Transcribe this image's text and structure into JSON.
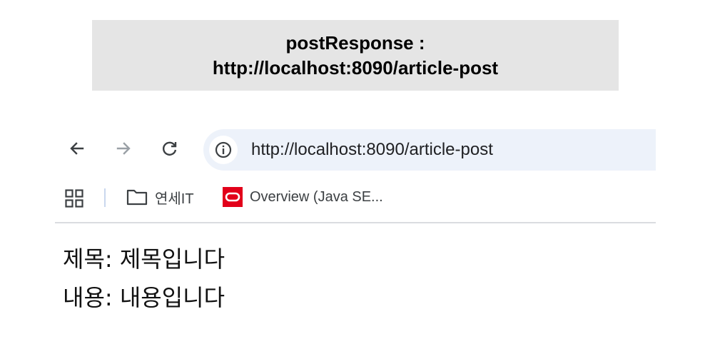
{
  "caption": {
    "line1": "postResponse :",
    "line2": "http://localhost:8090/article-post"
  },
  "browser": {
    "toolbar": {
      "back_icon": "arrow-left-icon",
      "forward_icon": "arrow-right-icon",
      "reload_icon": "reload-icon",
      "site_info_icon": "info-icon",
      "url": "http://localhost:8090/article-post"
    },
    "bookmarks": {
      "apps_icon": "apps-grid-icon",
      "items": [
        {
          "icon": "folder-icon",
          "label": "연세IT"
        },
        {
          "icon": "oracle-icon",
          "label": "Overview (Java SE..."
        }
      ]
    },
    "colors": {
      "omnibox_bg": "#edf2fa",
      "oracle_red": "#e2001a",
      "caption_bg": "#e5e5e5"
    }
  },
  "page": {
    "lines": [
      "제목: 제목입니다",
      "내용: 내용입니다"
    ]
  }
}
